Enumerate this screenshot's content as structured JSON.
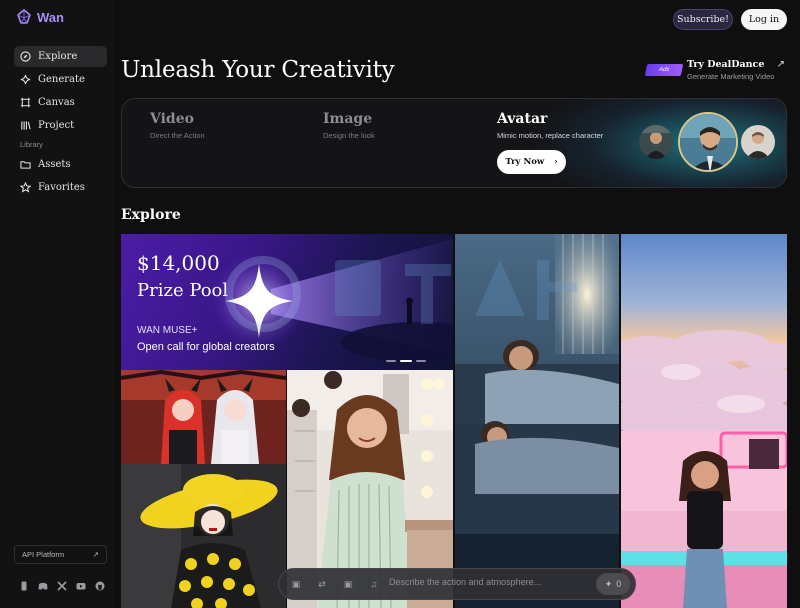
{
  "brand": {
    "name": "Wan"
  },
  "sidebar": {
    "items": [
      {
        "label": "Explore",
        "icon": "compass-icon",
        "active": true
      },
      {
        "label": "Generate",
        "icon": "sparkle-icon",
        "active": false
      },
      {
        "label": "Canvas",
        "icon": "canvas-icon",
        "active": false
      },
      {
        "label": "Project",
        "icon": "project-icon",
        "active": false
      }
    ],
    "section_label": "Library",
    "library_items": [
      {
        "label": "Assets",
        "icon": "folder-icon"
      },
      {
        "label": "Favorites",
        "icon": "star-icon"
      }
    ],
    "api_label": "API Platform",
    "socials": [
      "mobile-icon",
      "discord-icon",
      "x-icon",
      "youtube-icon",
      "github-icon"
    ]
  },
  "header": {
    "subscribe_label": "Subscribe!",
    "login_label": "Log in"
  },
  "hero": {
    "title": "Unleash Your Creativity"
  },
  "promo": {
    "badge": "Ads",
    "title": "Try DealDance",
    "subtitle": "Generate Marketing Video"
  },
  "modes": [
    {
      "title": "Video",
      "subtitle": "Direct the Action"
    },
    {
      "title": "Image",
      "subtitle": "Design the look"
    },
    {
      "title": "Avatar",
      "subtitle": "Mimic motion, replace character"
    }
  ],
  "try_now_label": "Try Now",
  "explore": {
    "title": "Explore",
    "banner": {
      "amount": "$14,000",
      "pool": "Prize Pool",
      "brand": "WAN MUSE+",
      "description": "Open call for global creators",
      "slide_count": 3,
      "active_slide": 2
    }
  },
  "prompt": {
    "placeholder": "Describe the action and atmosphere...",
    "send_count": "0"
  },
  "colors": {
    "accent": "#a98ef7",
    "background": "#0f0f10",
    "sidebar": "#121213",
    "glow": "#28bed2"
  }
}
